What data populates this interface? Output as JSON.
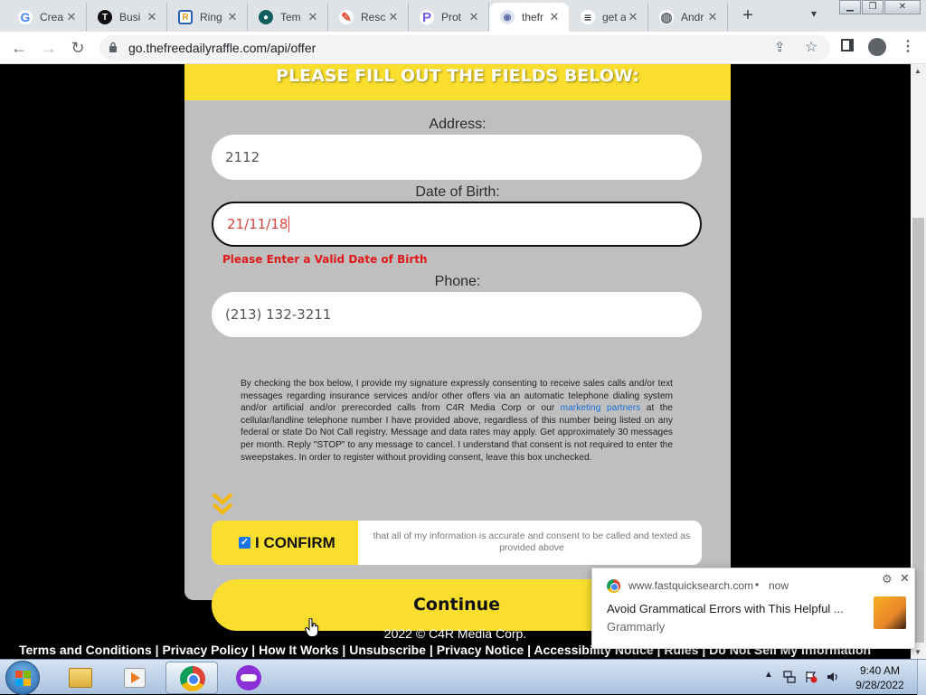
{
  "browser": {
    "tabs": [
      {
        "label": "Crea",
        "icon": "google-icon",
        "color": "#4285f4",
        "glyph": "G"
      },
      {
        "label": "Busi",
        "icon": "t-logo-icon",
        "color": "#111111",
        "glyph": "T"
      },
      {
        "label": "Ring",
        "icon": "r-logo-icon",
        "color": "#e59c1c",
        "glyph": "R"
      },
      {
        "label": "Tem",
        "icon": "template-icon",
        "color": "#0f5d5d",
        "glyph": "●"
      },
      {
        "label": "Resc",
        "icon": "pen-icon",
        "color": "#e0533a",
        "glyph": "✎"
      },
      {
        "label": "Prot",
        "icon": "p-logo-icon",
        "color": "#6f5ae6",
        "glyph": "P"
      },
      {
        "label": "thefr",
        "icon": "raffle-site-icon",
        "color": "#5b6ea6",
        "glyph": "◉"
      },
      {
        "label": "get a",
        "icon": "e-logo-icon",
        "color": "#111111",
        "glyph": "≡"
      },
      {
        "label": "Andr",
        "icon": "globe-icon",
        "color": "#5f6368",
        "glyph": "◍"
      }
    ],
    "active_tab_index": 6,
    "url": "go.thefreedailyraffle.com/api/offer"
  },
  "page": {
    "header": "PLEASE FILL OUT THE FIELDS BELOW:",
    "address": {
      "label": "Address:",
      "value": "2112"
    },
    "dob": {
      "label": "Date of Birth:",
      "value": "21/11/18",
      "error": "Please Enter a Valid Date of Birth"
    },
    "phone": {
      "label": "Phone:",
      "value": "(213) 132-3211"
    },
    "consent": {
      "part1": "By checking the box below, I provide my signature expressly consenting to receive sales calls and/or text messages regarding insurance services and/or other offers via an automatic telephone dialing system and/or artificial and/or prerecorded calls from C4R Media Corp or our",
      "link": "marketing partners",
      "part2": "at the cellular/landline telephone number I have provided above, regardless of this number being listed on any federal or state Do Not Call registry. Message and data rates may apply. Get approximately 30 messages per month. Reply \"STOP\" to any message to cancel. I understand that consent is not required to enter the sweepstakes. In order to register without providing consent, leave this box unchecked."
    },
    "confirm": {
      "label": "I CONFIRM",
      "checked": true,
      "description": "that all of my information is accurate and consent to be called and texted as provided above"
    },
    "continue_label": "Continue",
    "footer": {
      "copyright": "2022 © C4R Media Corp.",
      "links": "Terms and Conditions | Privacy Policy | How It Works | Unsubscribe | Privacy Notice | Accessibility Notice | Rules | Do Not Sell My Information"
    }
  },
  "notification": {
    "source": "www.fastquicksearch.com",
    "separator": "•",
    "time": "now",
    "title": "Avoid Grammatical Errors with This Helpful ...",
    "app": "Grammarly"
  },
  "taskbar": {
    "time": "9:40 AM",
    "date": "9/28/2022"
  },
  "colors": {
    "brand_yellow": "#f9de2e",
    "panel_gray": "#bfbfbf",
    "error_red": "#e0191a",
    "link_blue": "#1a6fd6"
  }
}
